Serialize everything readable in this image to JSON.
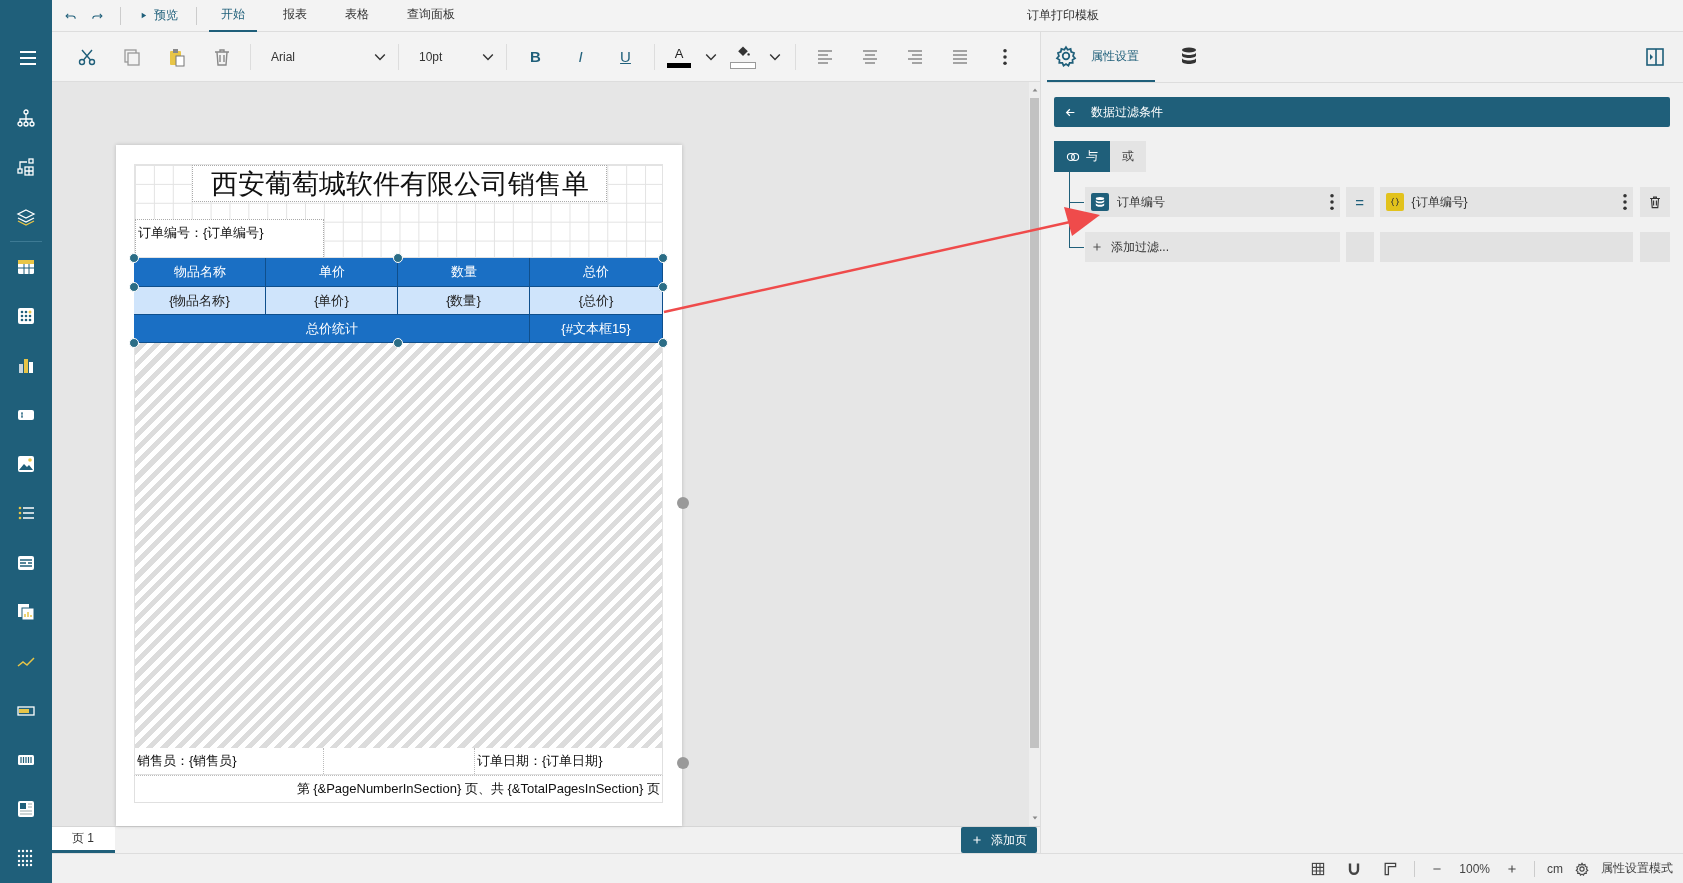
{
  "menu_bar": {
    "preview": "预览",
    "tabs": [
      {
        "label": "开始",
        "selected": true
      },
      {
        "label": "报表",
        "selected": false
      },
      {
        "label": "表格",
        "selected": false
      },
      {
        "label": "查询面板",
        "selected": false
      }
    ],
    "document_title": "订单打印模板"
  },
  "toolbar": {
    "font": "Arial",
    "font_size": "10pt",
    "format_buttons": [
      "B",
      "I",
      "U"
    ],
    "font_color_label": "A"
  },
  "report": {
    "title": "西安葡萄城软件有限公司销售单",
    "order_number": "订单编号：{订单编号}",
    "table": {
      "columns": [
        "物品名称",
        "单价",
        "数量",
        "总价"
      ],
      "row": [
        "{物品名称}",
        "{单价}",
        "{数量}",
        "{总价}"
      ],
      "total_label": "总价统计",
      "total_value": "{#文本框15}"
    },
    "footer": {
      "salesperson": "销售员：{销售员}",
      "order_date": "订单日期：{订单日期}",
      "page_text": "第 {&PageNumberInSection} 页、共 {&TotalPagesInSection} 页"
    }
  },
  "right_panel": {
    "tabs": [
      {
        "kind": "properties",
        "label": "属性设置",
        "selected": true
      },
      {
        "kind": "data",
        "selected": false
      }
    ],
    "filter": {
      "title": "数据过滤条件",
      "logic": [
        {
          "label": "与",
          "selected": true
        },
        {
          "label": "或",
          "selected": false
        }
      ],
      "conditions": [
        {
          "field": "订单编号",
          "operator": "=",
          "value": "{订单编号}"
        }
      ],
      "add_label": "添加过滤..."
    }
  },
  "page_tabs": [
    {
      "label": "页 1",
      "selected": true
    }
  ],
  "add_page": "添加页",
  "status_bar": {
    "zoom": "100%",
    "unit": "cm",
    "mode": "属性设置模式"
  }
}
